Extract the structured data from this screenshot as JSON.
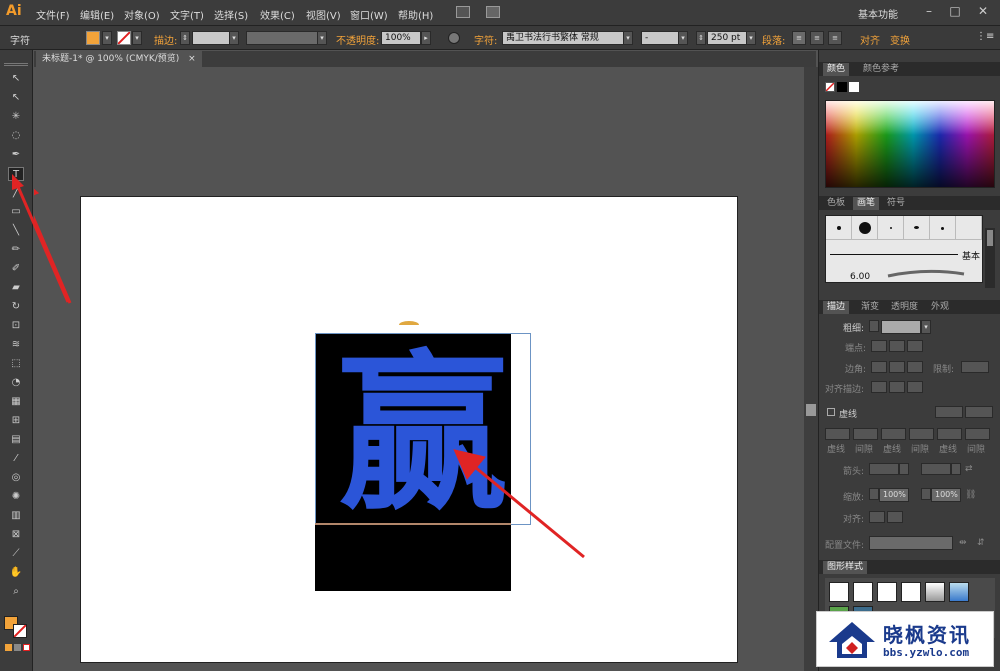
{
  "app": {
    "logo": "Ai"
  },
  "menu": [
    "文件(F)",
    "编辑(E)",
    "对象(O)",
    "文字(T)",
    "选择(S)",
    "效果(C)",
    "视图(V)",
    "窗口(W)",
    "帮助(H)"
  ],
  "workspace": "基本功能",
  "window_controls": {
    "min": "–",
    "max": "□",
    "close": "✕"
  },
  "control_bar": {
    "mode": "字符",
    "stroke_label": "描边:",
    "opacity_label": "不透明度:",
    "opacity_value": "100%",
    "char_label": "字符:",
    "font_name": "禹卫书法行书繁体",
    "font_style": "常规",
    "font_variant": "-",
    "font_size": "250 pt",
    "para_label": "段落:",
    "align_label": "对齐",
    "transform_label": "变换",
    "fill_color": "#f2a33a"
  },
  "document_tab": {
    "title": "未标题-1* @ 100% (CMYK/预览)",
    "close": "×"
  },
  "tools": [
    "selection",
    "direct-selection",
    "magic-wand",
    "lasso",
    "pen",
    "type",
    "line",
    "rectangle",
    "paintbrush",
    "pencil",
    "blob-brush",
    "eraser",
    "rotate",
    "scale",
    "width",
    "free-transform",
    "shape-builder",
    "perspective-grid",
    "mesh",
    "gradient",
    "eyedropper",
    "blend",
    "symbol-sprayer",
    "column-graph",
    "artboard",
    "slice",
    "hand",
    "zoom"
  ],
  "canvas": {
    "glyph": "赢",
    "glyph_color": "#2b55d8"
  },
  "panels": {
    "color_tabs": [
      "颜色",
      "颜色参考"
    ],
    "brush_tabs": [
      "色板",
      "画笔",
      "符号"
    ],
    "brush_label": "基本",
    "brush_size": "6.00",
    "stroke_tabs": [
      "描边",
      "渐变",
      "透明度",
      "外观"
    ],
    "weight_label": "粗细:",
    "cap_label": "端点:",
    "corner_label": "边角:",
    "limit_label": "限制:",
    "align_stroke_label": "对齐描边:",
    "dashed_label": "虚线",
    "dash_cols": [
      "虚线",
      "间隙",
      "虚线",
      "间隙",
      "虚线",
      "间隙"
    ],
    "arrow_label": "箭头:",
    "scale_label": "缩放:",
    "scale_values": [
      "100%",
      "100%"
    ],
    "align_label": "对齐:",
    "profile_label": "配置文件:",
    "graphic_styles_label": "图形样式"
  },
  "watermark": {
    "title": "晓枫资讯",
    "url": "bbs.yzwlo.com"
  }
}
